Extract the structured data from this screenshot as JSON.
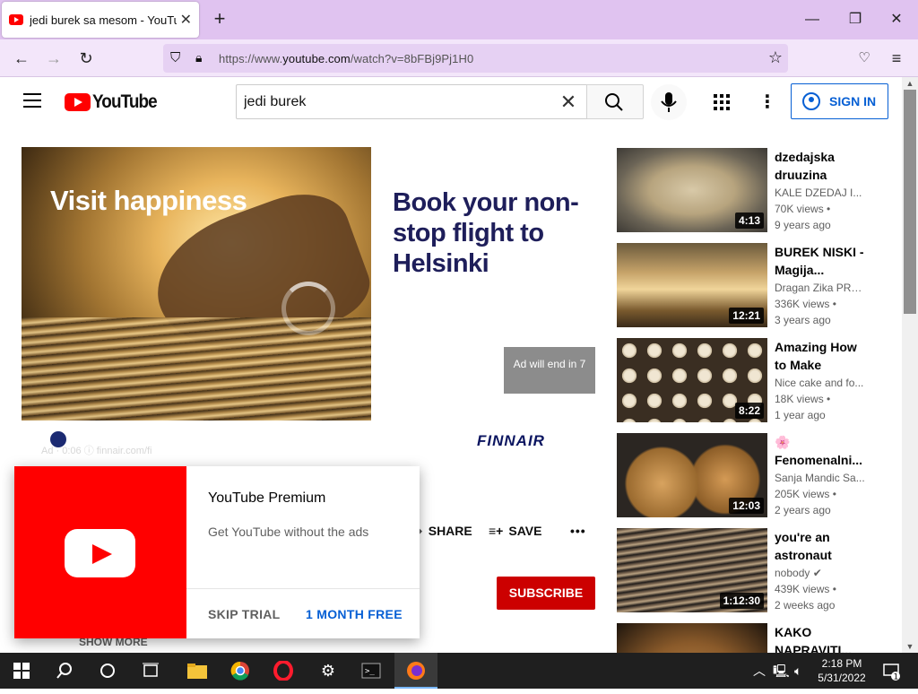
{
  "browser": {
    "tab_title": "jedi burek sa mesom - YouTube",
    "tab_close": "✕",
    "new_tab": "+",
    "url_prefix": "https://www.",
    "url_domain": "youtube.com",
    "url_path": "/watch?v=8bFBj9Pj1H0",
    "window_controls": [
      "—",
      "❐",
      "✕"
    ]
  },
  "youtube": {
    "logo_text": "YouTube",
    "search_value": "jedi burek",
    "sign_in": "SIGN IN"
  },
  "ad": {
    "image_headline": "Visit happiness",
    "headline": "Book your non-stop flight to Helsinki",
    "ad_will_end": "Ad will end in 7",
    "brand": "FINNAIR",
    "info": "Ad · 0:06 ⓘ  finnair.com/fi"
  },
  "actions": {
    "share": "SHARE",
    "save": "SAVE",
    "more": "•••",
    "subscribe": "SUBSCRIBE",
    "show_more": "SHOW MORE"
  },
  "premium": {
    "title": "YouTube Premium",
    "description": "Get YouTube without the ads",
    "skip": "SKIP TRIAL",
    "free": "1 MONTH FREE"
  },
  "related": [
    {
      "title": "dzedajska druuzina",
      "channel": "KALE DZEDAJ I...",
      "views": "70K views •",
      "ago": "9 years ago",
      "duration": "4:13"
    },
    {
      "title": "BUREK NISKI - Magija...",
      "channel": "Dragan Zika PRO...",
      "views": "336K views •",
      "ago": "3 years ago",
      "duration": "12:21"
    },
    {
      "title": "Amazing How to Make burek...",
      "channel": "Nice cake and fo...",
      "views": "18K views •",
      "ago": "1 year ago",
      "duration": "8:22"
    },
    {
      "title": "🌸 Fenomenalni...",
      "channel": "Sanja Mandic Sa...",
      "views": "205K views •",
      "ago": "2 years ago",
      "duration": "12:03"
    },
    {
      "title": "you're an astronaut lost...",
      "channel": "nobody ✔",
      "views": "439K views •",
      "ago": "2 weeks ago",
      "duration": "1:12:30"
    },
    {
      "title": "KAKO NAPRAVITI...",
      "channel": "",
      "views": "",
      "ago": "",
      "duration": ""
    }
  ],
  "taskbar": {
    "time": "2:18 PM",
    "date": "5/31/2022",
    "notifications": "1"
  }
}
